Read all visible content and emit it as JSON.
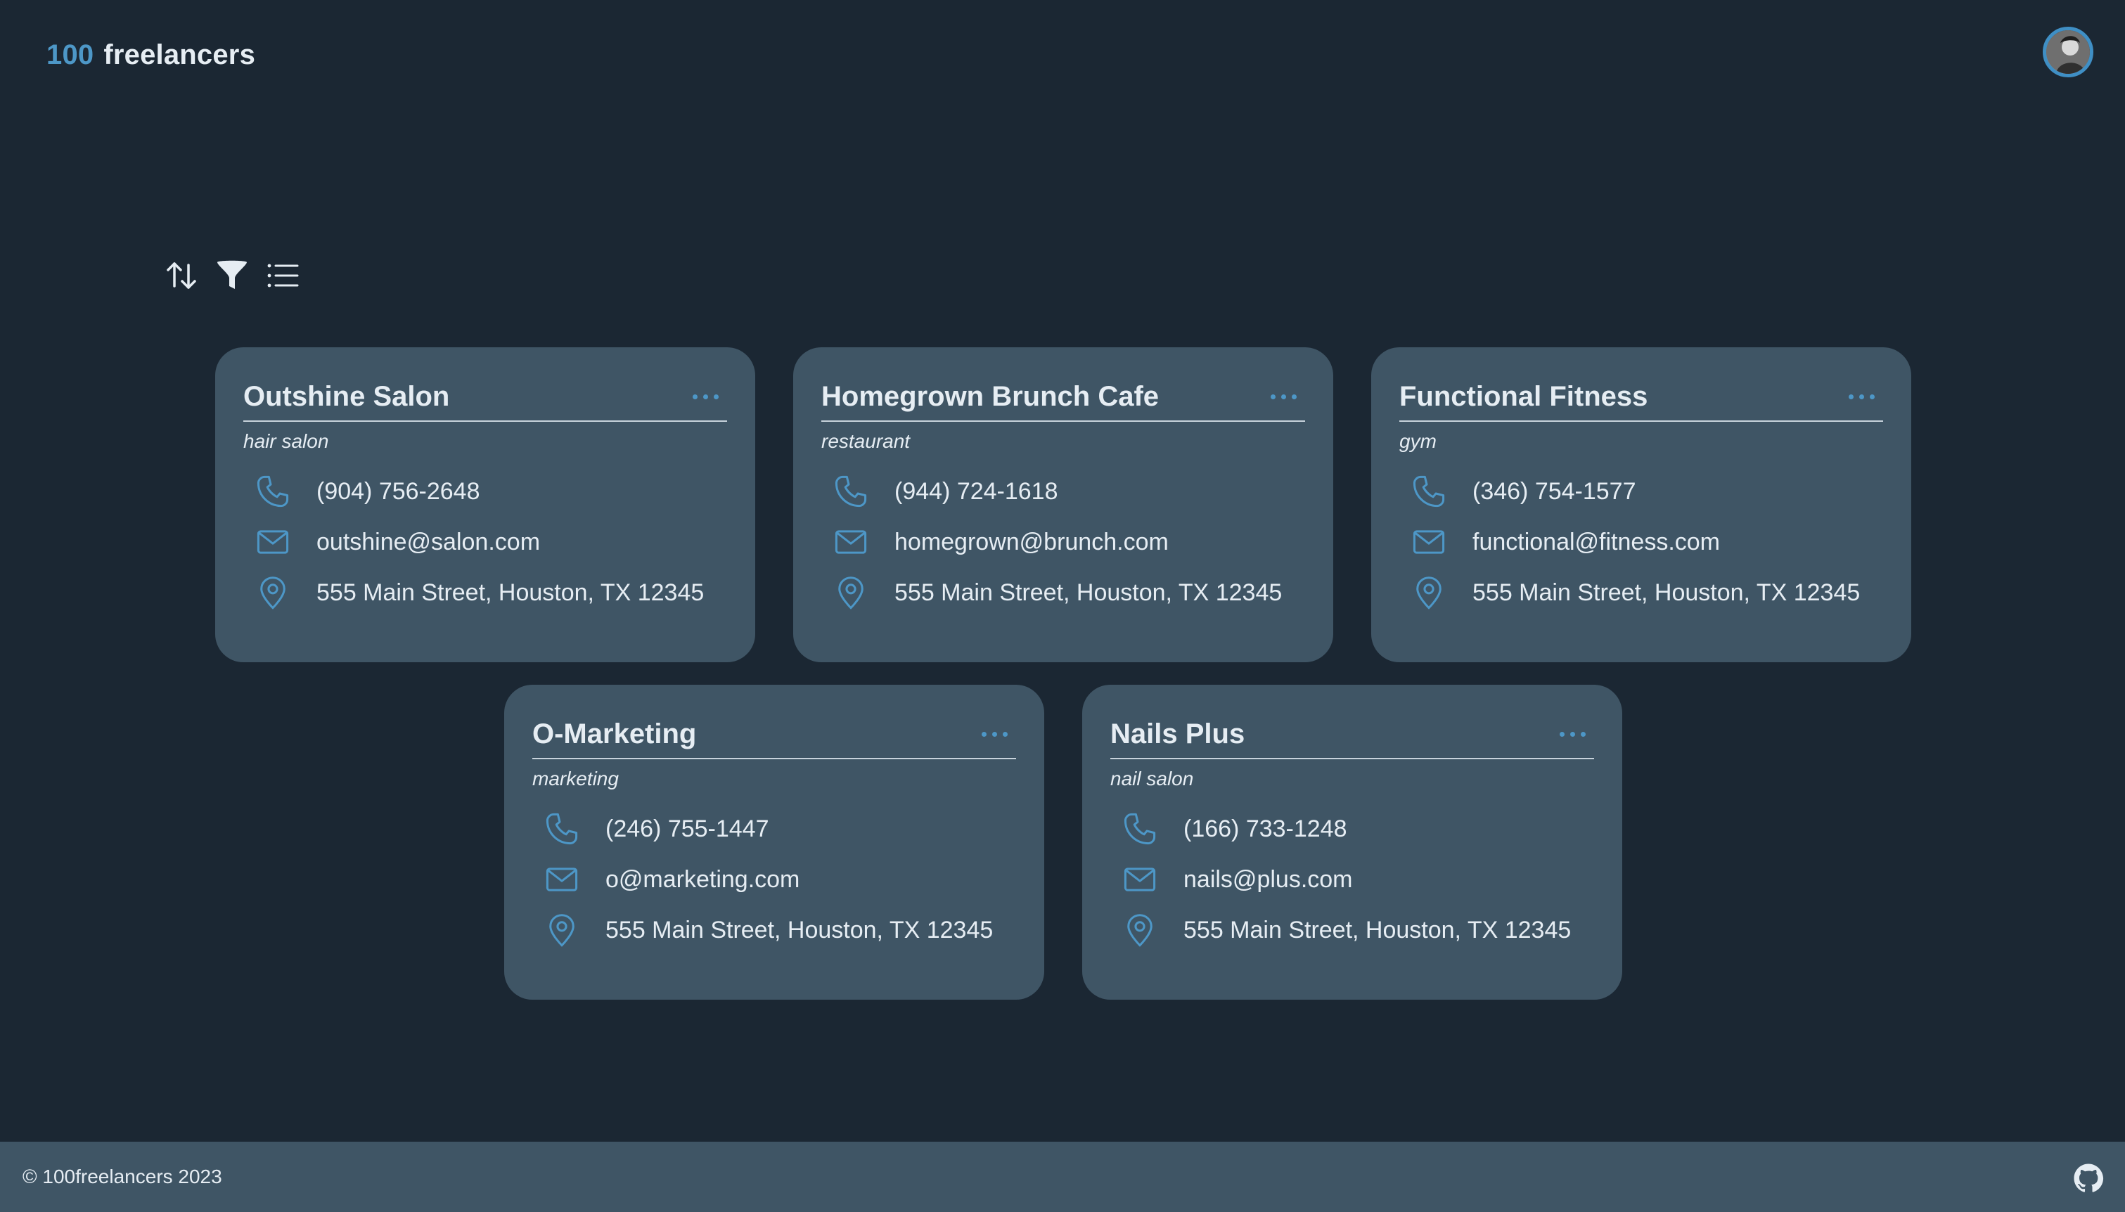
{
  "brand": {
    "number": "100",
    "word": "freelancers"
  },
  "toolbar": {
    "sort_icon": "sort-icon",
    "filter_icon": "filter-icon",
    "list_icon": "list-view-icon"
  },
  "colors": {
    "background": "#1b2733",
    "card": "#3f5565",
    "accent": "#4d97c7",
    "text": "#e6edf3"
  },
  "cards": [
    {
      "name": "Outshine Salon",
      "category": "hair salon",
      "phone": "(904) 756-2648",
      "email": "outshine@salon.com",
      "address": "555 Main Street, Houston, TX 12345"
    },
    {
      "name": "Homegrown Brunch Cafe",
      "category": "restaurant",
      "phone": "(944) 724-1618",
      "email": "homegrown@brunch.com",
      "address": "555 Main Street, Houston, TX 12345"
    },
    {
      "name": "Functional Fitness",
      "category": "gym",
      "phone": "(346) 754-1577",
      "email": "functional@fitness.com",
      "address": "555 Main Street, Houston, TX 12345"
    },
    {
      "name": "O-Marketing",
      "category": "marketing",
      "phone": "(246) 755-1447",
      "email": "o@marketing.com",
      "address": "555 Main Street, Houston, TX 12345"
    },
    {
      "name": "Nails Plus",
      "category": "nail salon",
      "phone": "(166) 733-1248",
      "email": "nails@plus.com",
      "address": "555 Main Street, Houston, TX 12345"
    }
  ],
  "footer": {
    "copyright": "© 100freelancers 2023",
    "github_icon": "github-icon"
  }
}
